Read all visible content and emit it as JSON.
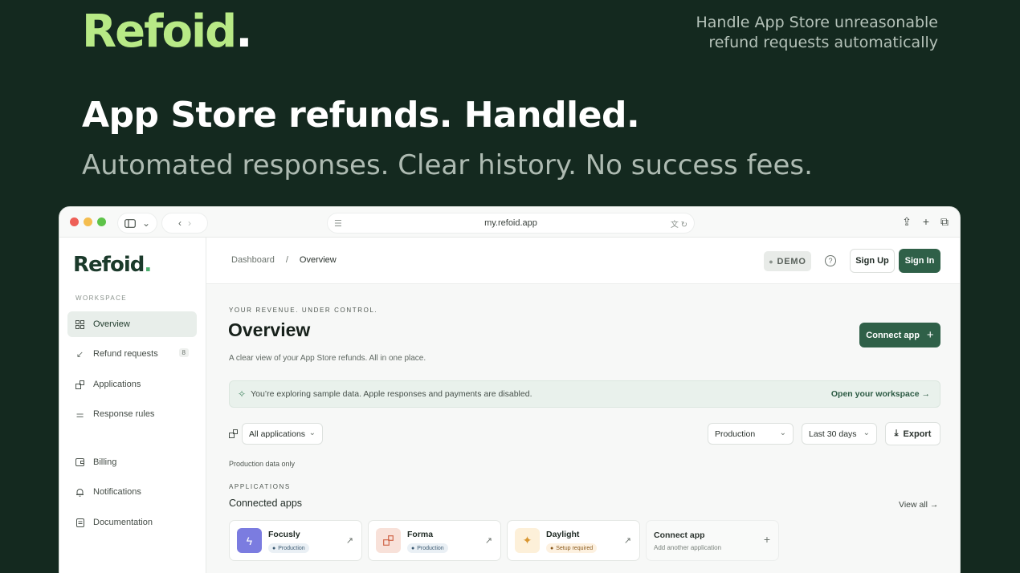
{
  "hero": {
    "logo": "Refoid",
    "logo_dot": ".",
    "tagline_line1": "Handle App Store unreasonable",
    "tagline_line2": "refund requests automatically",
    "headline": "App Store refunds. Handled.",
    "subheadline": "Automated responses. Clear history. No success fees."
  },
  "browser": {
    "url": "my.refoid.app"
  },
  "sidebar": {
    "logo": "Refoid",
    "logo_dot": ".",
    "section_label": "WORKSPACE",
    "items": [
      {
        "label": "Overview",
        "icon": "grid-icon",
        "active": true
      },
      {
        "label": "Refund requests",
        "icon": "arrow-down-left-icon",
        "badge": "8"
      },
      {
        "label": "Applications",
        "icon": "apps-icon"
      },
      {
        "label": "Response rules",
        "icon": "sliders-icon"
      },
      {
        "label": "Billing",
        "icon": "wallet-icon"
      },
      {
        "label": "Notifications",
        "icon": "bell-icon"
      },
      {
        "label": "Documentation",
        "icon": "document-icon"
      }
    ]
  },
  "topbar": {
    "breadcrumb_root": "Dashboard",
    "breadcrumb_sep": "/",
    "breadcrumb_current": "Overview",
    "demo_badge": "DEMO",
    "signup_label": "Sign Up",
    "signin_label": "Sign In"
  },
  "overview": {
    "eyebrow": "YOUR REVENUE. UNDER CONTROL.",
    "title": "Overview",
    "description": "A clear view of your App Store refunds. All in one place.",
    "connect_button": "Connect app",
    "banner_text": "You’re exploring sample data. Apple responses and payments are disabled.",
    "banner_link": "Open your workspace",
    "filter_apps": "All applications",
    "filter_env": "Production",
    "filter_range": "Last 30 days",
    "export_label": "Export",
    "production_note": "Production data only"
  },
  "applications": {
    "eyebrow": "APPLICATIONS",
    "title": "Connected apps",
    "view_all": "View all",
    "cards": [
      {
        "name": "Focusly",
        "status": "Production",
        "icon": "bolt-icon",
        "icon_bg": "#7b7ce0",
        "icon_color": "#ffffff"
      },
      {
        "name": "Forma",
        "status": "Production",
        "icon": "shapes-icon",
        "icon_bg": "#f8e1d9",
        "icon_color": "#d0674a"
      },
      {
        "name": "Daylight",
        "status": "Setup required",
        "icon": "sparkle-icon",
        "icon_bg": "#fdf0d9",
        "icon_color": "#d99631"
      }
    ],
    "connect_card_title": "Connect app",
    "connect_card_sub": "Add another application"
  },
  "colors": {
    "background": "#14291f",
    "accent_green": "#2f6048",
    "logo_green": "#b8e986"
  }
}
